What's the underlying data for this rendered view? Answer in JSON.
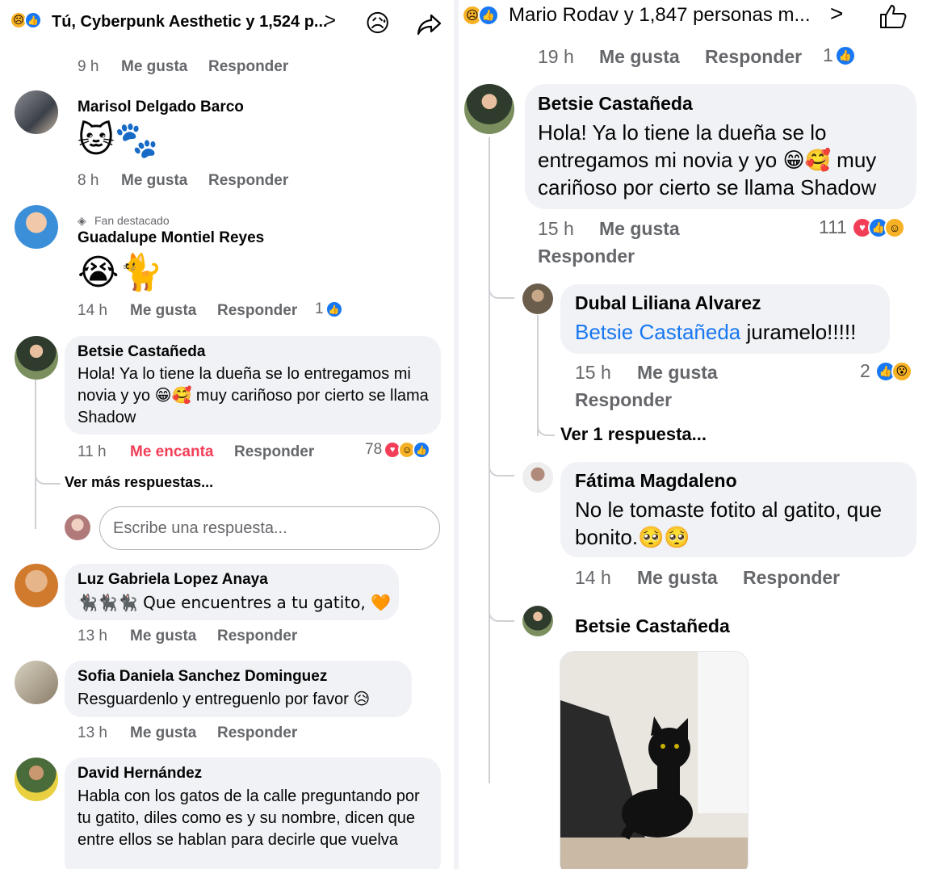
{
  "left": {
    "header": {
      "reactions_icons": [
        "sad-emoji",
        "like"
      ],
      "summary": "Tú, Cyberpunk Aesthetic y 1,524 p...",
      "chevron": ">",
      "sad_icon": "😥",
      "share_icon": "share-arrow"
    },
    "top_meta": {
      "time": "9 h",
      "like": "Me gusta",
      "reply": "Responder"
    },
    "comments": [
      {
        "name": "Marisol Delgado Barco",
        "emoji_text": "🐱🐾",
        "time": "8 h",
        "like": "Me gusta",
        "reply": "Responder"
      },
      {
        "badge": "Fan destacado",
        "name": "Guadalupe Montiel Reyes",
        "emoji_text": "😭🐈",
        "time": "14 h",
        "like": "Me gusta",
        "reply": "Responder",
        "react_count": "1"
      },
      {
        "name": "Betsie Castañeda",
        "text": "Hola! Ya lo tiene la dueña se lo entregamos mi novia y yo 😁🥰 muy cariñoso por cierto se llama Shadow",
        "time": "11 h",
        "like": "Me encanta",
        "reply": "Responder",
        "react_count": "78"
      },
      {
        "name": "Luz Gabriela Lopez Anaya",
        "text": "🐈‍⬛🐈‍⬛🐈‍⬛ Que encuentres a tu gatito, 🧡",
        "time": "13 h",
        "like": "Me gusta",
        "reply": "Responder"
      },
      {
        "name": "Sofia Daniela Sanchez Dominguez",
        "text": "Resguardenlo y entreguenlo por favor 😥",
        "time": "13 h",
        "like": "Me gusta",
        "reply": "Responder"
      },
      {
        "name": "David Hernández",
        "text": "Habla con los gatos de la calle preguntando por tu gatito, diles como es y su nombre, dicen que entre ellos se hablan para decirle que vuelva"
      }
    ],
    "more_replies": "Ver más respuestas...",
    "reply_placeholder": "Escribe una respuesta..."
  },
  "right": {
    "header": {
      "summary": "Mario Rodav y 1,847 personas m...",
      "chevron": ">",
      "like_icon": "thumbs-up-outline"
    },
    "top_meta": {
      "time": "19 h",
      "like": "Me gusta",
      "reply": "Responder",
      "react_count": "1"
    },
    "main_comment": {
      "name": "Betsie Castañeda",
      "text": "Hola! Ya lo tiene la dueña se lo entregamos mi novia y yo 😁🥰 muy cariñoso por cierto se llama Shadow",
      "time": "15 h",
      "like": "Me gusta",
      "reply": "Responder",
      "react_count": "111"
    },
    "replies": [
      {
        "name": "Dubal Liliana Alvarez",
        "mention": "Betsie Castañeda",
        "text": " juramelo!!!!!",
        "time": "15 h",
        "like": "Me gusta",
        "reply": "Responder",
        "react_count": "2",
        "more": "Ver 1 respuesta..."
      },
      {
        "name": "Fátima Magdaleno",
        "text": "No le tomaste fotito al gatito, que bonito.🥺🥺",
        "time": "14 h",
        "like": "Me gusta",
        "reply": "Responder"
      },
      {
        "name": "Betsie Castañeda",
        "photo": "black-cat-photo"
      }
    ]
  },
  "colors": {
    "like_blue": "#1877f2",
    "love_red": "#f33e58",
    "meta_gray": "#65676b",
    "bubble_gray": "#f0f2f5"
  }
}
